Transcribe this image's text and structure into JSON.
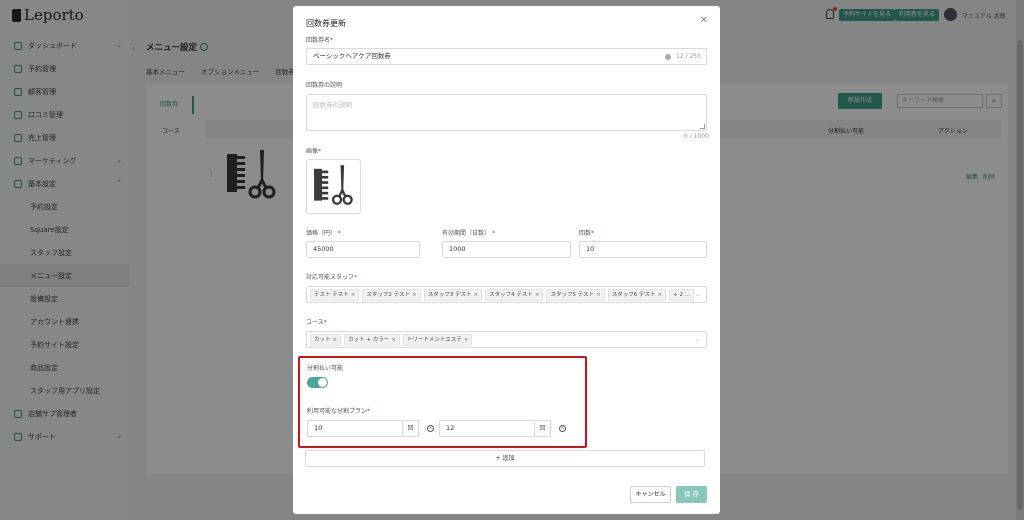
{
  "app": {
    "brand": "Leporto"
  },
  "sidebar": {
    "items": [
      {
        "label": "ダッシュボード",
        "icon": "dashboard-icon",
        "expandable": true
      },
      {
        "label": "予約管理",
        "icon": "list-icon"
      },
      {
        "label": "顧客管理",
        "icon": "customer-icon"
      },
      {
        "label": "口コミ管理",
        "icon": "review-icon"
      },
      {
        "label": "売上管理",
        "icon": "sales-icon"
      },
      {
        "label": "マーケティング",
        "icon": "marketing-icon",
        "expandable": true
      },
      {
        "label": "基本設定",
        "icon": "settings-icon",
        "expandable": true
      }
    ],
    "subitems": [
      "予約設定",
      "Square設定",
      "スタッフ設定",
      "メニュー設定",
      "設備設定",
      "アカウント連携",
      "予約サイト設定",
      "商品設定",
      "スタッフ用アプリ設定"
    ],
    "active_sub": "メニュー設定",
    "bottom_items": [
      {
        "label": "店舗サブ管理者",
        "icon": "users-icon"
      },
      {
        "label": "サポート",
        "icon": "support-icon",
        "expandable": true
      }
    ]
  },
  "topbar": {
    "btn_site": "予約サイトを見る",
    "btn_manual": "利用者を見る",
    "user": "マニュアル 太郎"
  },
  "page": {
    "title": "メニュー設定",
    "tabs": [
      "基本メニュー",
      "オプションメニュー",
      "回数券"
    ],
    "subnav": "回数券",
    "course_label": "コース",
    "new_button": "新規作成",
    "search_placeholder": "キーワード検索",
    "col_split": "分割払い可能",
    "col_action": "アクション",
    "edit": "編集",
    "delete": "削除"
  },
  "modal": {
    "title": "回数券更新",
    "name_label": "回数券名",
    "name_value": "ベーシックヘアケア回数券",
    "name_counter": "12 / 255",
    "desc_label": "回数券の説明",
    "desc_placeholder": "回数券の説明",
    "desc_counter": "0 / 1000",
    "image_label": "画像",
    "image_icon": "comb-scissors-icon",
    "price_label": "価格（円）",
    "price_value": "45000",
    "period_label": "有効期間（日数）",
    "period_value": "1000",
    "count_label": "回数",
    "count_value": "10",
    "staff_label": "対応可能スタッフ",
    "staff_tags": [
      "テスト テスト",
      "スタッフ2 テスト",
      "スタッフ3 テスト",
      "スタッフ4 テスト",
      "スタッフ5 テスト",
      "スタッフ6 テスト",
      "+ 2 ..."
    ],
    "course_label": "コース",
    "course_tags": [
      "カット",
      "カット + カラー",
      "トリートメントエステ"
    ],
    "split_label": "分割払い可能",
    "split_enabled": true,
    "plans_label": "利用可能な分割プラン",
    "plans": [
      "10",
      "12"
    ],
    "plan_unit": "回",
    "add_label": "追加",
    "cancel_label": "キャンセル",
    "save_label": "保 存"
  }
}
